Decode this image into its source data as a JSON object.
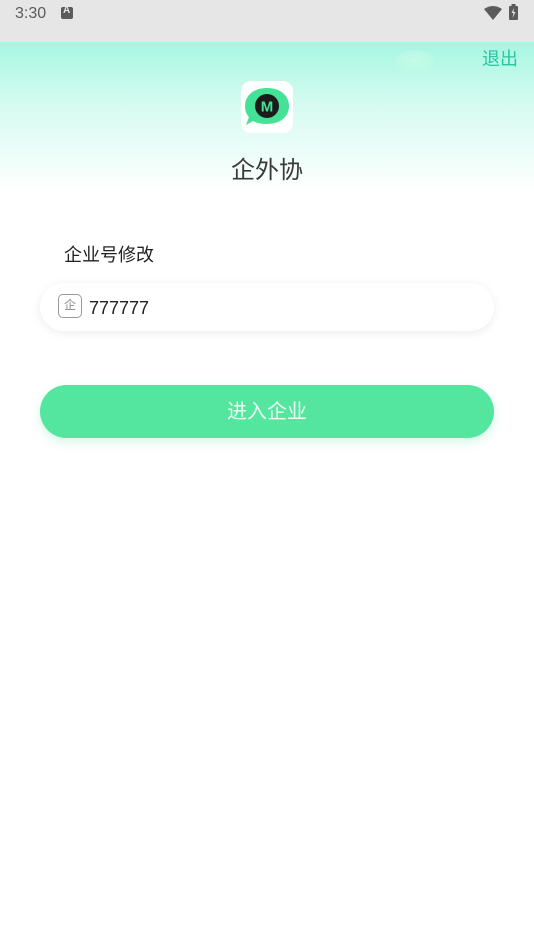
{
  "status_bar": {
    "time": "3:30",
    "notification_icon": "a-notification-icon",
    "wifi_icon": "wifi-icon",
    "battery_icon": "battery-icon"
  },
  "header": {
    "logout_label": "退出",
    "logo_letter": "M",
    "app_title": "企外协"
  },
  "form": {
    "section_label": "企业号修改",
    "enterprise_icon_char": "企",
    "enterprise_id_value": "777777",
    "submit_label": "进入企业"
  },
  "colors": {
    "accent": "#54e59f",
    "logout_text": "#26c6a0",
    "header_gradient_top": "#a6f6e1"
  }
}
